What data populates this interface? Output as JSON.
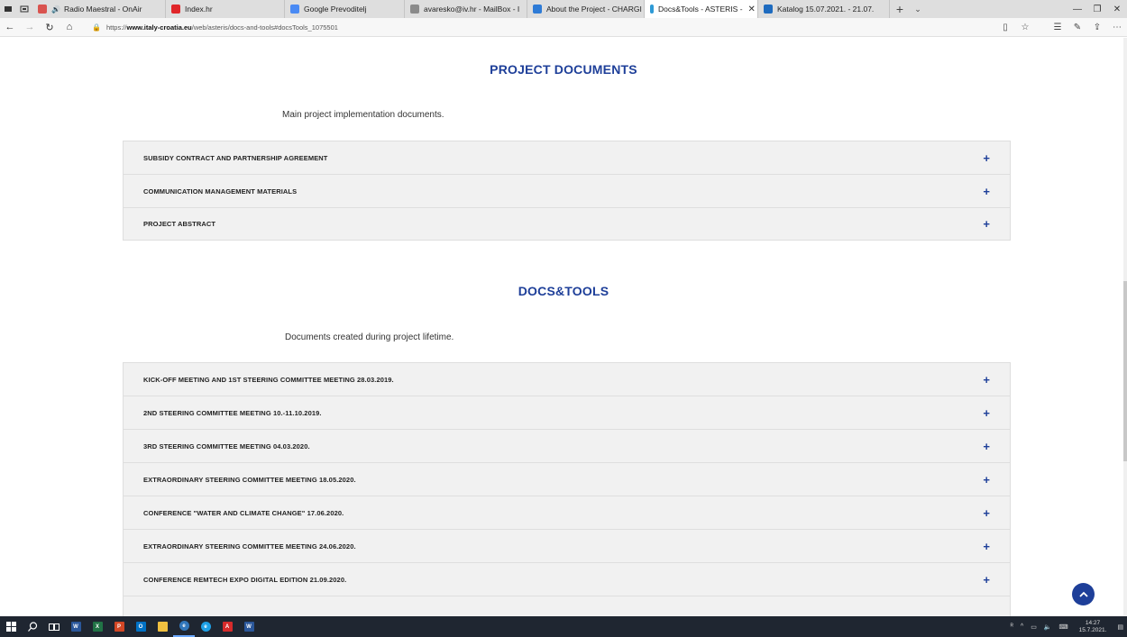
{
  "browser": {
    "tabs": [
      {
        "label": "Radio Maestral - OnAir",
        "active": false,
        "favicon_color": "#d9534f"
      },
      {
        "label": "Index.hr",
        "active": false,
        "favicon_color": "#e0262a"
      },
      {
        "label": "Google Prevoditelj",
        "active": false,
        "favicon_color": "#4a8af4"
      },
      {
        "label": "avaresko@iv.hr - MailBox - I",
        "active": false,
        "favicon_color": "#8a8a8a"
      },
      {
        "label": "About the Project - CHARGI",
        "active": false,
        "favicon_color": "#2e7bd6"
      },
      {
        "label": "Docs&Tools - ASTERIS -",
        "active": true,
        "favicon_color": "#2e9ad6"
      },
      {
        "label": "Katalog 15.07.2021. - 21.07.",
        "active": false,
        "favicon_color": "#1e6bbf"
      }
    ],
    "url_prefix": "https://",
    "url_host": "www.italy-croatia.eu",
    "url_path": "/web/asteris/docs-and-tools#docsTools_1075501"
  },
  "sections": [
    {
      "title": "PROJECT DOCUMENTS",
      "description": "Main project implementation documents.",
      "items": [
        "SUBSIDY CONTRACT AND PARTNERSHIP AGREEMENT",
        "COMMUNICATION MANAGEMENT MATERIALS",
        "PROJECT ABSTRACT"
      ]
    },
    {
      "title": "DOCS&TOOLS",
      "description": "Documents created during project lifetime.",
      "items": [
        "KICK-OFF MEETING AND 1ST STEERING COMMITTEE MEETING 28.03.2019.",
        "2ND STEERING COMMITTEE MEETING 10.-11.10.2019.",
        "3RD STEERING COMMITTEE MEETING 04.03.2020.",
        "EXTRAORDINARY STEERING COMMITTEE MEETING 18.05.2020.",
        "CONFERENCE \"WATER AND CLIMATE CHANGE\" 17.06.2020.",
        "EXTRAORDINARY STEERING COMMITTEE MEETING 24.06.2020.",
        "CONFERENCE REMTECH EXPO DIGITAL EDITION 21.09.2020."
      ]
    }
  ],
  "accordion_expand_glyph": "+",
  "taskbar": {
    "clock_time": "14:27",
    "clock_date": "15.7.2021."
  },
  "colors": {
    "accent": "#1e3f99",
    "accordion_bg": "#f1f1f1",
    "taskbar_bg": "#1f2631"
  }
}
